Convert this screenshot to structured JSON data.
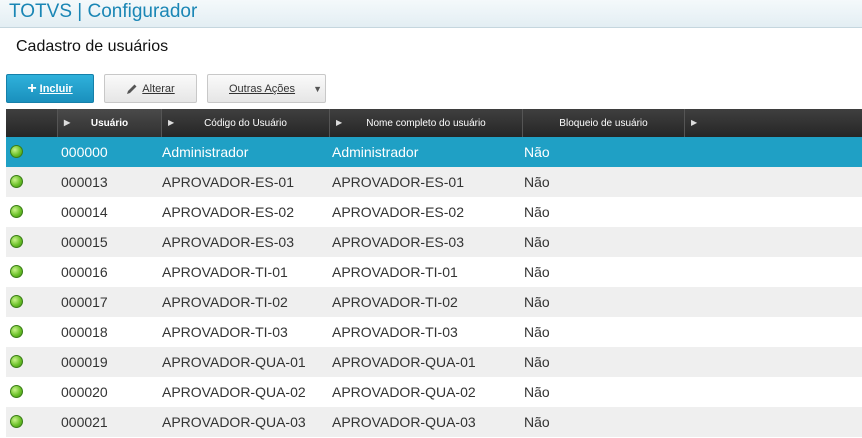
{
  "app": {
    "title": "TOTVS | Configurador"
  },
  "page": {
    "title": "Cadastro de usuários"
  },
  "toolbar": {
    "include_label": "Incluir",
    "alter_label": "Alterar",
    "other_label": "Outras Ações"
  },
  "grid": {
    "columns": [
      "Usuário",
      "Código do Usuário",
      "Nome completo do usuário",
      "Bloqueio de usuário"
    ],
    "rows": [
      {
        "usuario": "000000",
        "codigo": "Administrador",
        "nome": "Administrador",
        "bloqueio": "Não"
      },
      {
        "usuario": "000013",
        "codigo": "APROVADOR-ES-01",
        "nome": "APROVADOR-ES-01",
        "bloqueio": "Não"
      },
      {
        "usuario": "000014",
        "codigo": "APROVADOR-ES-02",
        "nome": "APROVADOR-ES-02",
        "bloqueio": "Não"
      },
      {
        "usuario": "000015",
        "codigo": "APROVADOR-ES-03",
        "nome": "APROVADOR-ES-03",
        "bloqueio": "Não"
      },
      {
        "usuario": "000016",
        "codigo": "APROVADOR-TI-01",
        "nome": "APROVADOR-TI-01",
        "bloqueio": "Não"
      },
      {
        "usuario": "000017",
        "codigo": "APROVADOR-TI-02",
        "nome": "APROVADOR-TI-02",
        "bloqueio": "Não"
      },
      {
        "usuario": "000018",
        "codigo": "APROVADOR-TI-03",
        "nome": "APROVADOR-TI-03",
        "bloqueio": "Não"
      },
      {
        "usuario": "000019",
        "codigo": "APROVADOR-QUA-01",
        "nome": "APROVADOR-QUA-01",
        "bloqueio": "Não"
      },
      {
        "usuario": "000020",
        "codigo": "APROVADOR-QUA-02",
        "nome": "APROVADOR-QUA-02",
        "bloqueio": "Não"
      },
      {
        "usuario": "000021",
        "codigo": "APROVADOR-QUA-03",
        "nome": "APROVADOR-QUA-03",
        "bloqueio": "Não"
      }
    ]
  },
  "colors": {
    "accent": "#1fa0c5",
    "status_active": "#6cc12a"
  },
  "icons": {
    "include": "plus-icon",
    "alter": "pencil-icon",
    "other": "caret-down-icon",
    "status": "status-dot-icon",
    "column": "column-arrow-icon"
  }
}
